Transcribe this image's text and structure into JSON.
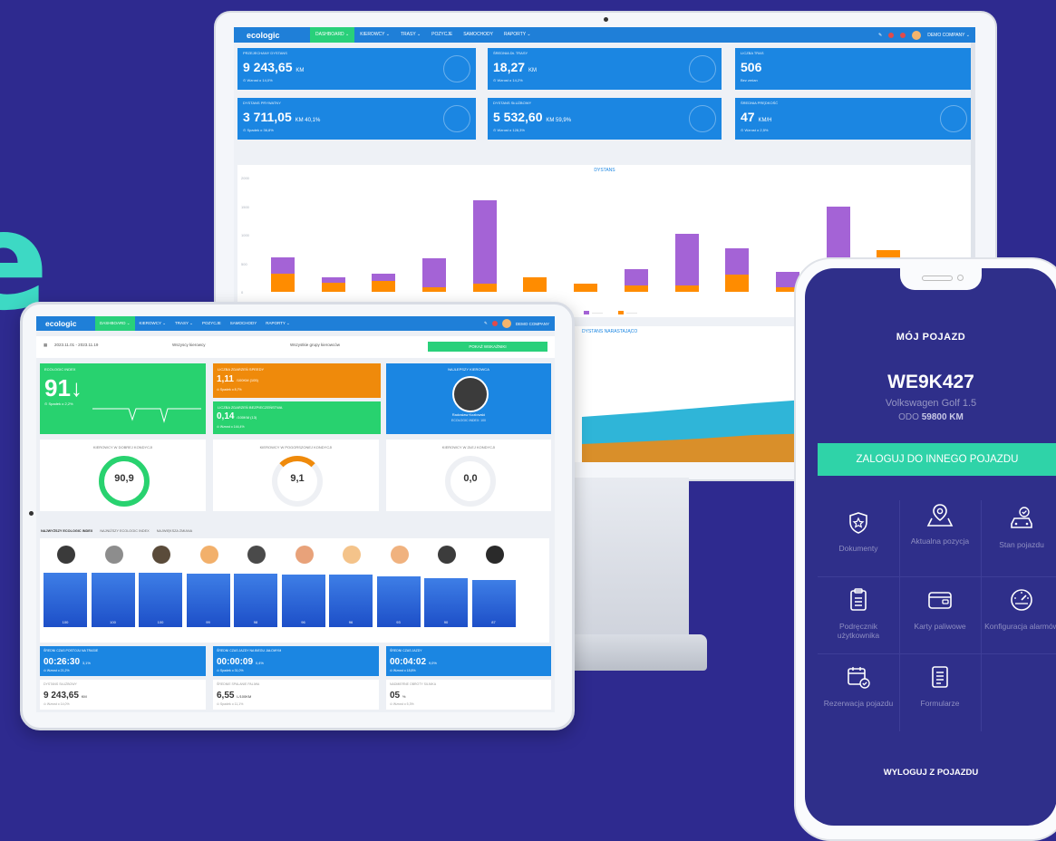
{
  "hero_letter": "e",
  "desktop": {
    "logo": "ecologic",
    "nav": [
      "DASHBOARD ⌄",
      "KIEROWCY ⌄",
      "TRASY ⌄",
      "POZYCJE",
      "SAMOCHODY",
      "RAPORTY ⌄"
    ],
    "nav_right": "DEMO COMPANY ⌄",
    "stats": [
      {
        "label": "PRZEJECHANY DYSTANS",
        "value": "9 243,65",
        "unit": "KM",
        "sub": "⊙ Wzrost o 14,0%"
      },
      {
        "label": "ŚREDNIA DŁ TRASY",
        "value": "18,27",
        "unit": "KM",
        "sub": "⊙ Wzrost o 14,2%"
      },
      {
        "label": "LICZBA TRAS",
        "value": "506",
        "unit": "",
        "sub": "Bez zmian"
      },
      {
        "label": "DYSTANS PRYWATNY",
        "value": "3 711,05",
        "unit": "KM  40,1%",
        "sub": "⊙ Spadek o 36,8%"
      },
      {
        "label": "DYSTANS SŁUŻBOWY",
        "value": "5 532,60",
        "unit": "KM  59,9%",
        "sub": "⊙ Wzrost o 128,3%"
      },
      {
        "label": "ŚREDNIA PRĘDKOŚĆ",
        "value": "47",
        "unit": "KM/H",
        "sub": "⊙ Wzrost o 2,5%"
      }
    ],
    "chart_title": "DYSTANS",
    "chart2_title": "DYSTANS NARASTAJĄCO"
  },
  "chart_data": {
    "type": "bar",
    "title": "DYSTANS",
    "ylim": [
      0,
      2000
    ],
    "yticks": [
      "2000",
      "1500",
      "1000",
      "500",
      "0"
    ],
    "series": [
      {
        "color": "#ff8c00",
        "values": [
          320,
          160,
          190,
          80,
          150,
          260,
          140,
          110,
          110,
          300,
          80,
          80,
          730,
          580
        ]
      },
      {
        "color": "#a463d6",
        "values": [
          280,
          100,
          120,
          500,
          1450,
          0,
          0,
          280,
          900,
          460,
          270,
          1420,
          0,
          0
        ]
      }
    ]
  },
  "tablet": {
    "logo": "ecologic",
    "nav": [
      "DASHBOARD ⌄",
      "KIEROWCY ⌄",
      "TRASY ⌄",
      "POZYCJE",
      "SAMOCHODY",
      "RAPORTY ⌄"
    ],
    "nav_right": "DEMO COMPANY",
    "date_range": "2023.11.01 - 2023.11.19",
    "filter1": "Wszyscy kierowcy",
    "filter2": "Wszystkie grupy kierowców",
    "apply_button": "POKAŻ WSKAŹNIKI",
    "eco_label": "ECOLOGIC INDEX",
    "eco_value": "91↓",
    "eco_sub": "⊙ Spadek o 2,2%",
    "events1_label": "LICZBA ZDARZEŃ SPEEDY",
    "events1_value": "1,11",
    "events1_unit": "/100KM (105)",
    "events1_sub": "⊙ Spadek o 8,7%",
    "events2_label": "LICZBA ZDARZEŃ BEZPIECZEŃSTWA",
    "events2_value": "0,14",
    "events2_unit": "/100KM (13)",
    "events2_sub": "⊙ Wzrost o 144,4%",
    "best_label": "NAJLEPSZY KIEROWCA",
    "best_name": "Radosław Kozłowski",
    "best_score": "ECOLOGIC INDEX: 100",
    "ring1_label": "KIEROWCY W DOBREJ KONDYCJI",
    "ring1_value": "90,9",
    "ring2_label": "KIEROWCY W POGORSZONEJ KONDYCJI",
    "ring2_value": "9,1",
    "ring3_label": "KIEROWCY W ZŁEJ KONDYCJI",
    "ring3_value": "0,0",
    "tabs": [
      "NAJWYŻSZY ECOLOGIC INDEX",
      "NAJNIŻSZY ECOLOGIC INDEX",
      "NAJWIĘKSZA ZMIANA"
    ],
    "drivers": [
      "100",
      "100",
      "100",
      "99",
      "98",
      "96",
      "96",
      "93",
      "90",
      "87"
    ],
    "minis": [
      {
        "label": "ŚREDNI CZAS POSTOJU NA TRASIE",
        "value": "00:26:30",
        "unit": "3,1%",
        "sub": "⊙ Wzrost o 21,2%"
      },
      {
        "label": "ŚREDNI CZAS JAZDY NA BIEGU JAŁOWYM",
        "value": "00:00:09",
        "unit": "0,4%",
        "sub": "⊙ Spadek o 31,0%"
      },
      {
        "label": "ŚREDNI CZAS JAZDY",
        "value": "00:04:02",
        "unit": "9,0%",
        "sub": "⊙ Wzrost o 18,8%"
      },
      {
        "label": "DYSTANS SŁUŻBOWY",
        "value": "9 243,65",
        "unit": "KM",
        "sub": "⊙ Wzrost o 14,0%"
      },
      {
        "label": "ŚREDNIE SPALANIE PALIWA",
        "value": "6,55",
        "unit": "L/100KM",
        "sub": "⊙ Spadek o 11,1%"
      },
      {
        "label": "NADMIERNE OBROTY SILNIKA",
        "value": "05",
        "unit": "%",
        "sub": "⊙ Wzrost o 5,3%"
      }
    ]
  },
  "phone": {
    "title": "MÓJ POJAZD",
    "plate": "WE9K427",
    "model": "Volkswagen Golf 1.5",
    "odo_prefix": "ODO",
    "odo_value": "59800 KM",
    "login_button": "ZALOGUJ DO INNEGO POJAZDU",
    "tiles": [
      "Dokumenty",
      "Aktualna pozycja",
      "Stan pojazdu",
      "Podręcznik użytkownika",
      "Karty paliwowe",
      "Konfiguracja alarmów",
      "Rezerwacja pojazdu",
      "Formularze"
    ],
    "logout": "WYLOGUJ Z POJAZDU",
    "icons": [
      "shield-star-icon",
      "map-pin-icon",
      "car-check-icon",
      "clipboard-icon",
      "wallet-card-icon",
      "speedometer-icon",
      "calendar-check-icon",
      "list-document-icon"
    ]
  }
}
